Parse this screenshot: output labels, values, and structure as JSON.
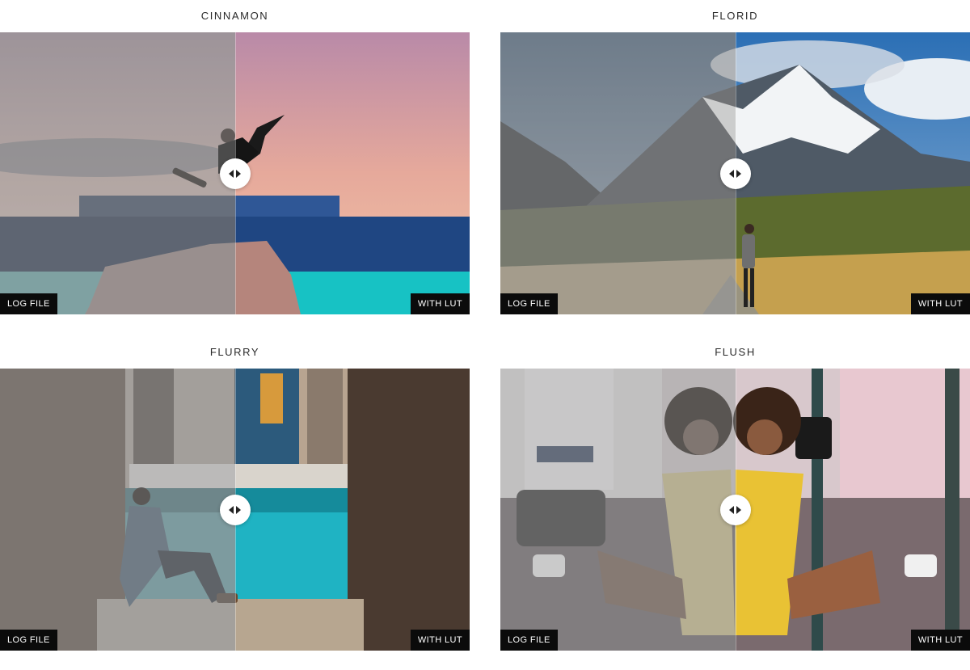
{
  "cards": [
    {
      "title": "CINNAMON",
      "left_label": "LOG FILE",
      "right_label": "WITH LUT"
    },
    {
      "title": "FLORID",
      "left_label": "LOG FILE",
      "right_label": "WITH LUT"
    },
    {
      "title": "FLURRY",
      "left_label": "LOG FILE",
      "right_label": "WITH LUT"
    },
    {
      "title": "FLUSH",
      "left_label": "LOG FILE",
      "right_label": "WITH LUT"
    }
  ],
  "slider_position": 0.5
}
